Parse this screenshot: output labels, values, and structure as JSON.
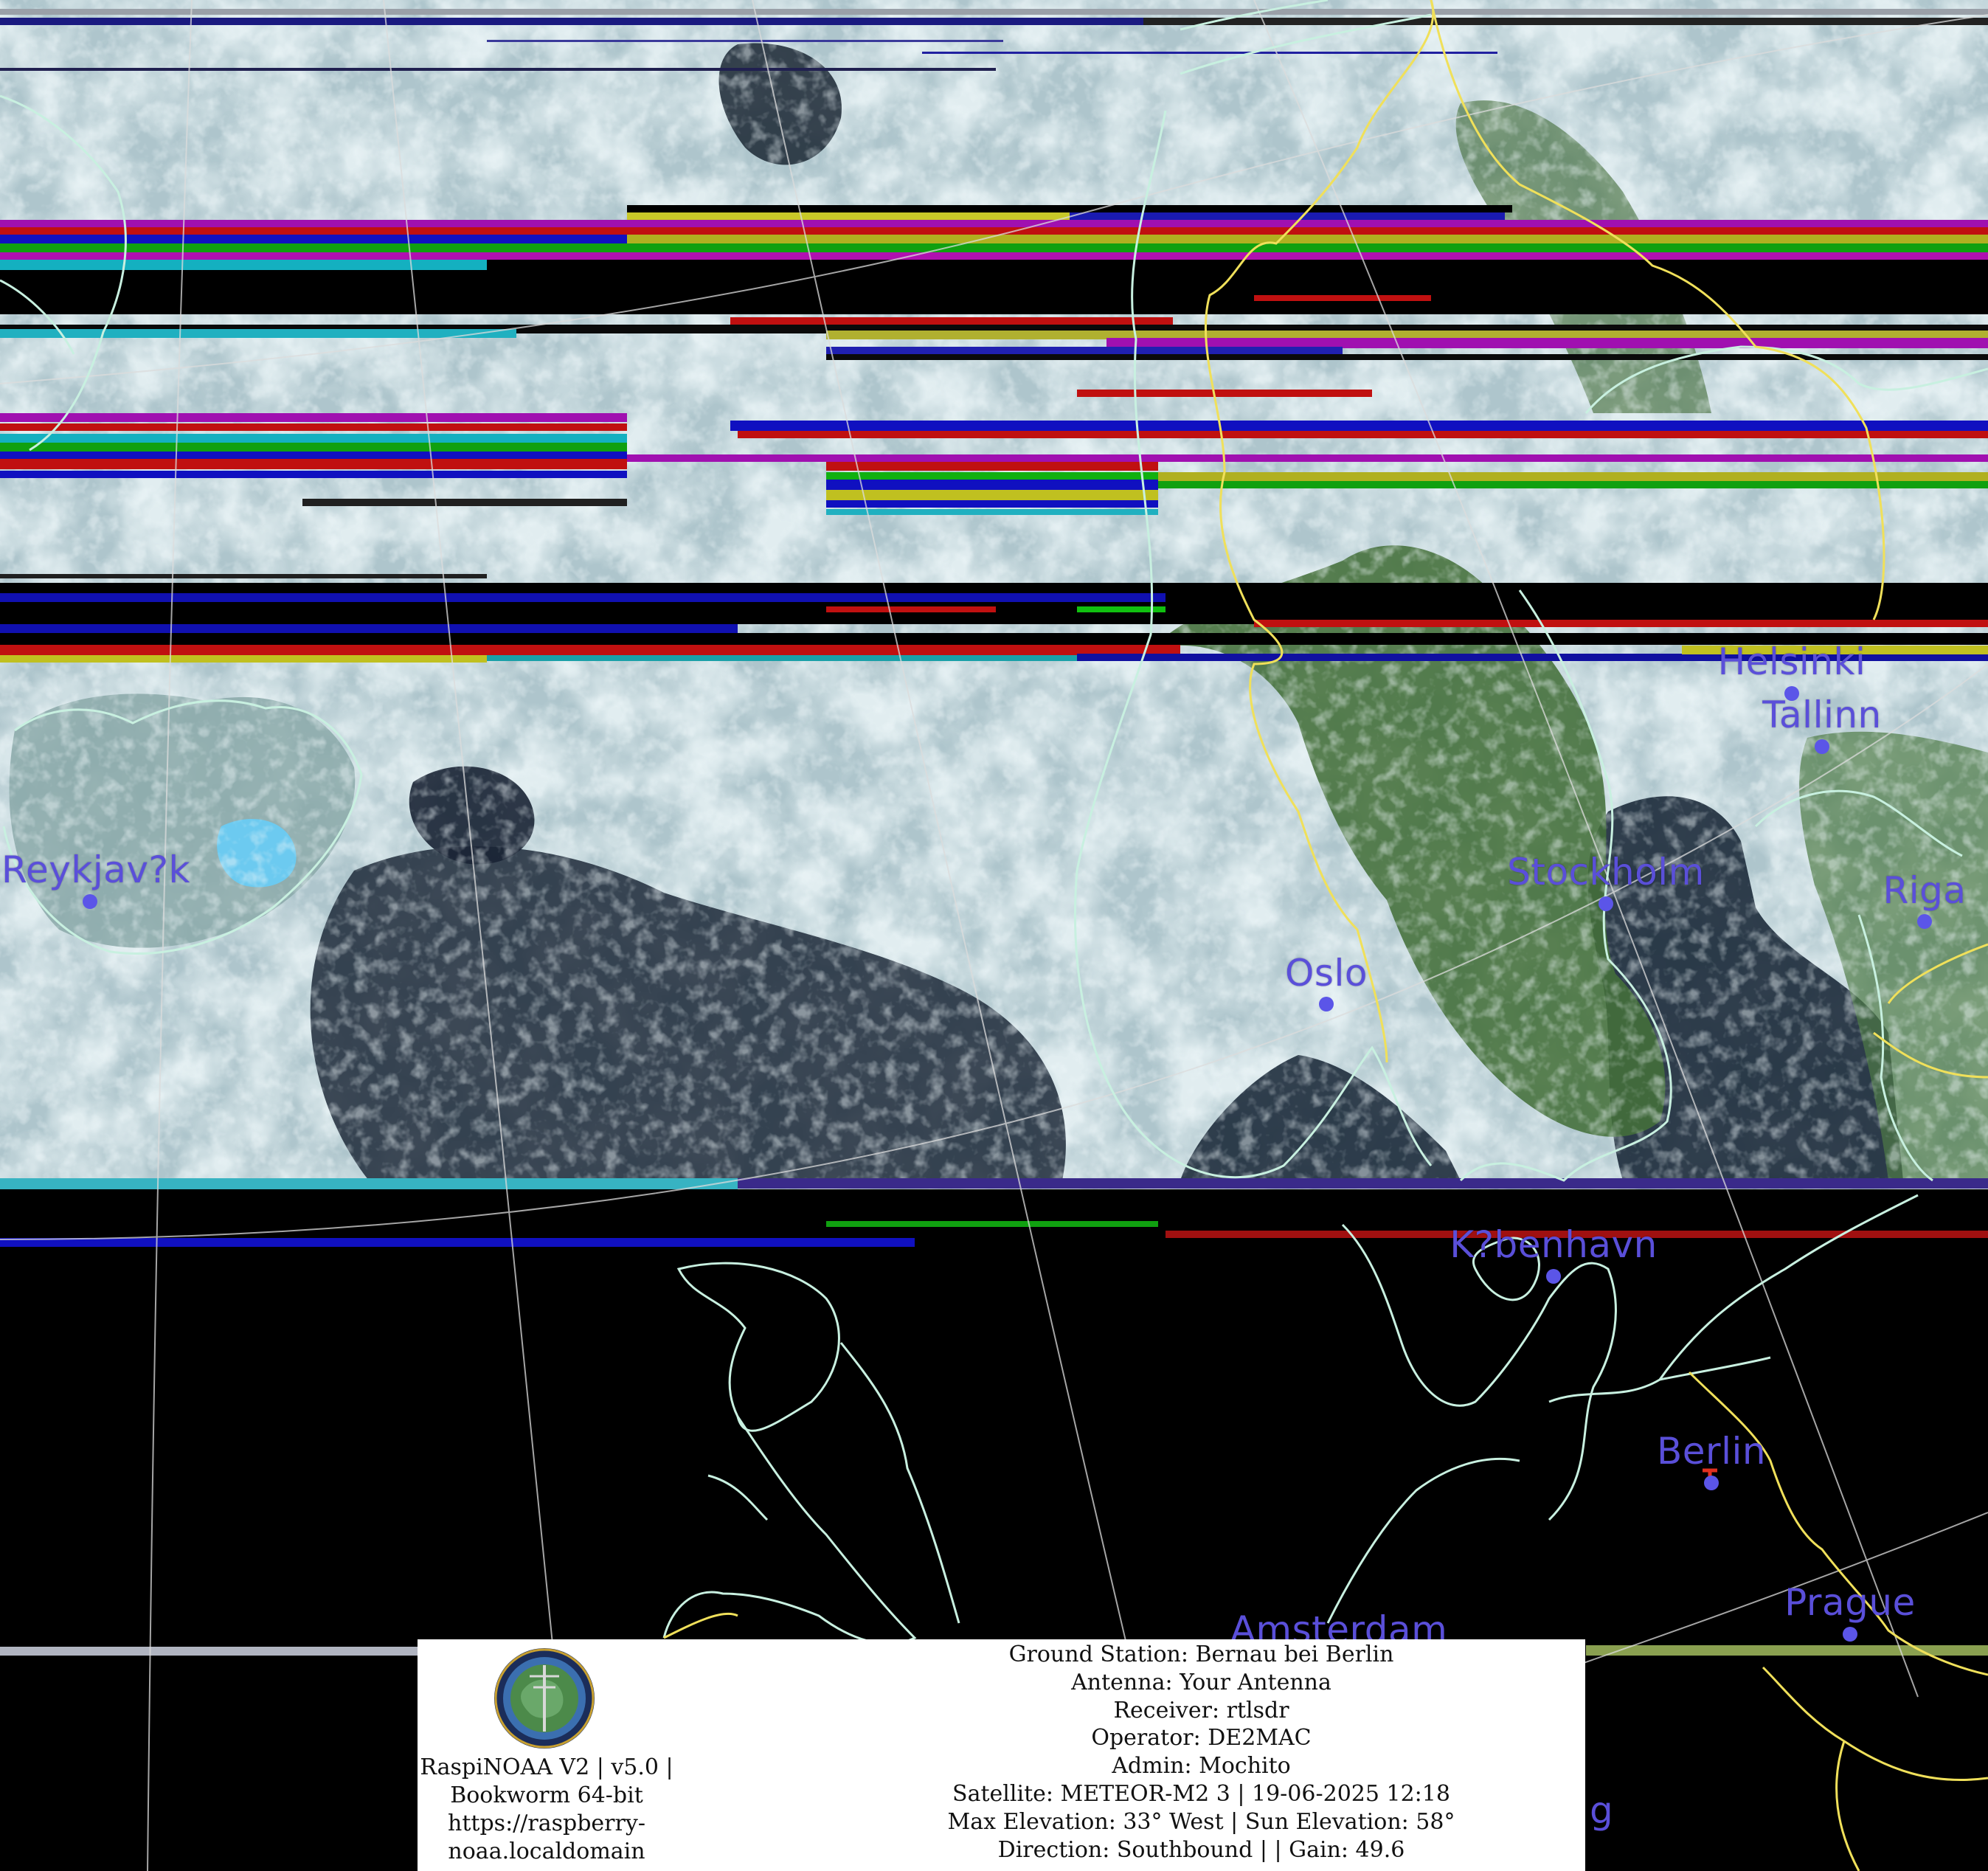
{
  "image": {
    "title": "",
    "colors": {
      "background": "#000000",
      "coastline": "#c8f0e0",
      "border": "#f0e05a",
      "graticule": "#dcdcdc",
      "city_label": "#5a4fd9",
      "city_dot": "#5b55e8",
      "ground_station_marker": "#e03020",
      "cloud": "#cfe4e8",
      "ocean": "#1c2636",
      "land": "#3f6a35"
    }
  },
  "cities": [
    {
      "id": "reykjavik",
      "name": "Reykjav?k"
    },
    {
      "id": "oslo",
      "name": "Oslo"
    },
    {
      "id": "stockholm",
      "name": "Stockholm"
    },
    {
      "id": "helsinki",
      "name": "Helsinki"
    },
    {
      "id": "tallinn",
      "name": "Tallinn"
    },
    {
      "id": "riga",
      "name": "Riga"
    },
    {
      "id": "kobenhavn",
      "name": "K?benhavn"
    },
    {
      "id": "berlin",
      "name": "Berlin"
    },
    {
      "id": "prague",
      "name": "Prague"
    },
    {
      "id": "amsterdam",
      "name": "Amsterdam"
    }
  ],
  "overflow_label": "g",
  "info_panel": {
    "logo": "raspinoaa-emblem",
    "left_lines": [
      "RaspiNOAA V2 | v5.0 |",
      "Bookworm 64-bit",
      "https://raspberry-",
      "noaa.localdomain"
    ],
    "right_lines": [
      "Ground Station: Bernau bei Berlin",
      "Antenna: Your Antenna",
      "Receiver: rtlsdr",
      "Operator: DE2MAC",
      "Admin: Mochito",
      "Satellite: METEOR-M2 3 | 19-06-2025 12:18",
      "Max Elevation: 33° West | Sun Elevation: 58°",
      "Direction: Southbound | | Gain: 49.6"
    ]
  }
}
